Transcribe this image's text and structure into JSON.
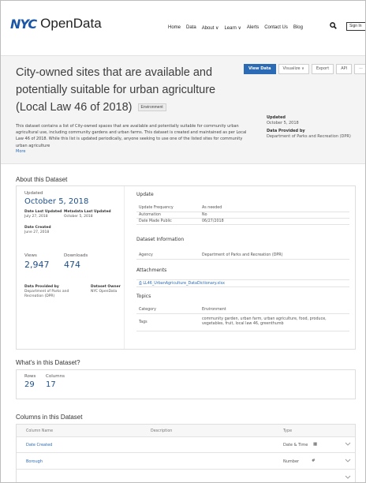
{
  "header": {
    "logo_mark": "NYC",
    "logo_text": "OpenData",
    "nav": [
      "Home",
      "Data",
      "About ∨",
      "Learn ∨",
      "Alerts",
      "Contact Us",
      "Blog"
    ],
    "signin": "Sign In"
  },
  "hero": {
    "title": "City-owned sites that are available and potentially suitable for urban agriculture (Local Law 46 of 2018)",
    "category_badge": "Environment",
    "buttons": {
      "view_data": "View Data",
      "visualize": "Visualize ∨",
      "export": "Export",
      "api": "API",
      "more": "···"
    },
    "description": "This dataset contains a list of City-owned spaces that are available and potentially suitable for community urban agricultural use, including community gardens and urban farms. This dataset is created and maintained as per Local Law 46 of 2018. While this list is updated periodically, anyone seeking to use one of the listed sites for community urban agriculture",
    "more_link": "More",
    "updated_label": "Updated",
    "updated_value": "October 5, 2018",
    "provided_by_label": "Data Provided by",
    "provided_by_value": "Department of Parks and Recreation (DPR)"
  },
  "about": {
    "heading": "About this Dataset",
    "updated_label": "Updated",
    "updated_value": "October 5, 2018",
    "data_last_updated_label": "Date Last Updated",
    "data_last_updated_value": "July 27, 2018",
    "metadata_last_updated_label": "Metadata Last Updated",
    "metadata_last_updated_value": "October 5, 2018",
    "date_created_label": "Date Created",
    "date_created_value": "June 27, 2018",
    "views_label": "Views",
    "views_value": "2,947",
    "downloads_label": "Downloads",
    "downloads_value": "474",
    "provided_by_label": "Data Provided by",
    "provided_by_value": "Department of Parks and Recreation (DPR)",
    "owner_label": "Dataset Owner",
    "owner_value": "NYC OpenData",
    "update_heading": "Update",
    "update_rows": [
      [
        "Update Frequency",
        "As needed"
      ],
      [
        "Automation",
        "No"
      ],
      [
        "Date Made Public",
        "06/27/2018"
      ]
    ],
    "info_heading": "Dataset Information",
    "info_rows": [
      [
        "Agency",
        "Department of Parks and Recreation (DPR)"
      ]
    ],
    "attachments_heading": "Attachments",
    "attachment": "LL46_UrbanAgriculture_DataDictionary.xlsx",
    "topics_heading": "Topics",
    "topics_rows": [
      [
        "Category",
        "Environment"
      ],
      [
        "Tags",
        "community garden, urban farm, urban agriculture, food, produce, vegetables, fruit, local law 46, greenthumb"
      ]
    ]
  },
  "whats_in": {
    "heading": "What's in this Dataset?",
    "rows_label": "Rows",
    "rows_value": "29",
    "columns_label": "Columns",
    "columns_value": "17"
  },
  "columns": {
    "heading": "Columns in this Dataset",
    "col_name": "Column Name",
    "col_desc": "Description",
    "col_type": "Type",
    "rows": [
      {
        "name": "Date Created",
        "type": "Date & Time",
        "glyph": "▦"
      },
      {
        "name": "Borough",
        "type": "Number",
        "glyph": "#"
      }
    ]
  }
}
